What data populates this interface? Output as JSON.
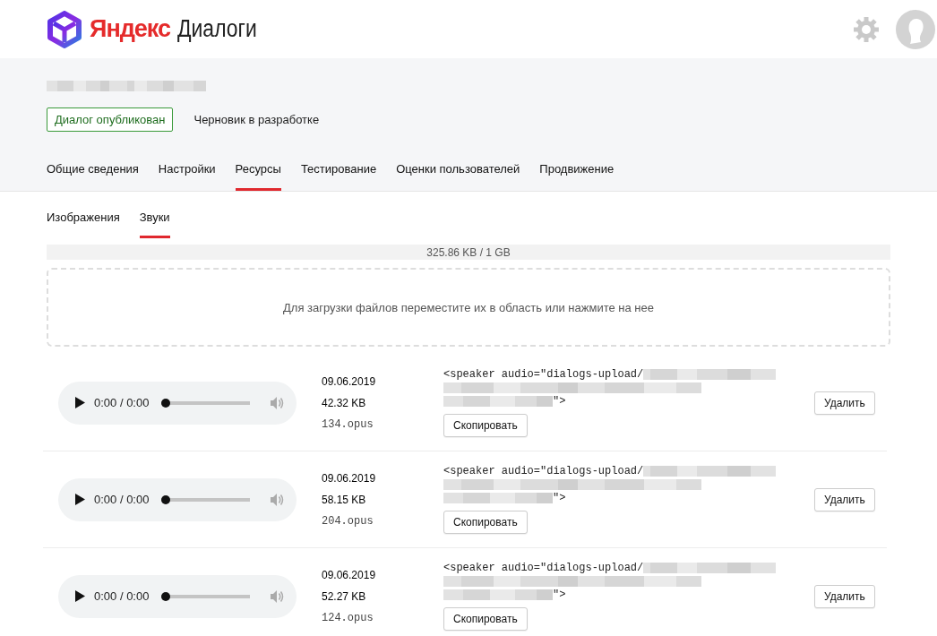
{
  "header": {
    "logo_brand": "Яндекс",
    "logo_product": "Диалоги"
  },
  "status_buttons": [
    {
      "label": "Диалог опубликован",
      "selected": true
    },
    {
      "label": "Черновик в разработке",
      "selected": false
    }
  ],
  "tabs": [
    {
      "label": "Общие сведения",
      "selected": false
    },
    {
      "label": "Настройки",
      "selected": false
    },
    {
      "label": "Ресурсы",
      "selected": true
    },
    {
      "label": "Тестирование",
      "selected": false
    },
    {
      "label": "Оценки пользователей",
      "selected": false
    },
    {
      "label": "Продвижение",
      "selected": false
    }
  ],
  "subtabs": [
    {
      "label": "Изображения",
      "selected": false
    },
    {
      "label": "Звуки",
      "selected": true
    }
  ],
  "storage": {
    "reading": "325.86 KB / 1 GB"
  },
  "dropzone": {
    "text": "Для загрузки файлов переместите их в область или нажмите на нее"
  },
  "sounds": [
    {
      "time": "0:00 / 0:00",
      "level": 0,
      "date": "09.06.2019",
      "size": "42.32 KB",
      "filename": "134.opus",
      "code_start": "<speaker audio=\"dialogs-upload/",
      "code_end": "\">",
      "copy_button": "Скопировать",
      "delete_button": "Удалить"
    },
    {
      "time": "0:00 / 0:00",
      "level": 0,
      "date": "09.06.2019",
      "size": "58.15 KB",
      "filename": "204.opus",
      "code_start": "<speaker audio=\"dialogs-upload/",
      "code_end": "\">",
      "copy_button": "Скопировать",
      "delete_button": "Удалить"
    },
    {
      "time": "0:00 / 0:00",
      "level": 0,
      "date": "09.06.2019",
      "size": "52.27 KB",
      "filename": "124.opus",
      "code_start": "<speaker audio=\"dialogs-upload/",
      "code_end": "\">",
      "copy_button": "Скопировать",
      "delete_button": "Удалить"
    }
  ]
}
